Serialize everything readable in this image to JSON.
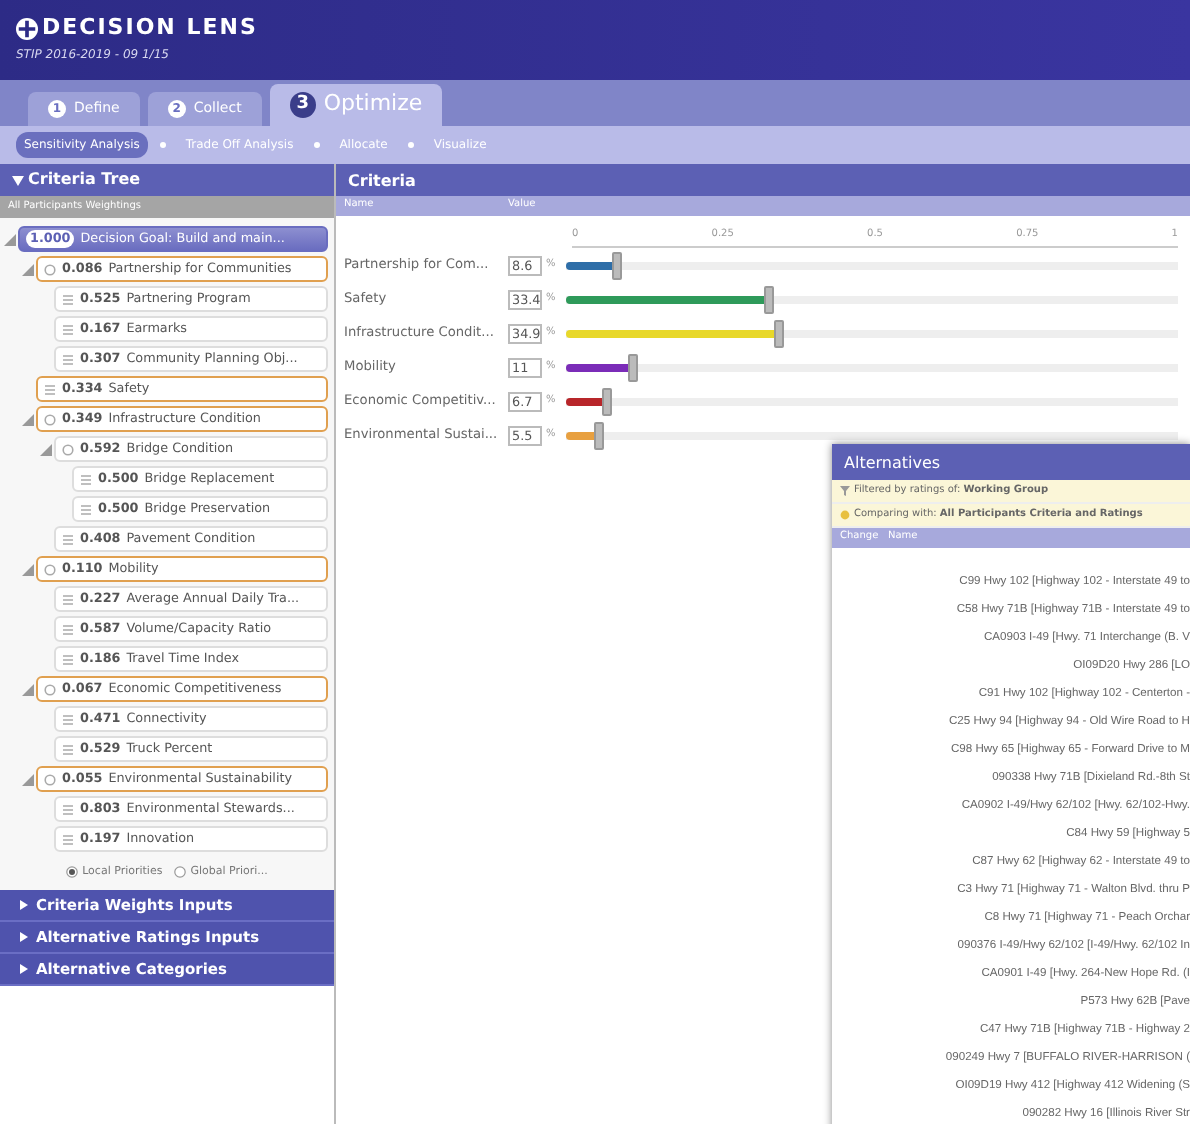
{
  "app": {
    "title": "DECISION LENS",
    "subtitle": "STIP 2016-2019 - 09 1/15"
  },
  "tabs": [
    {
      "number": "1",
      "label": "Define",
      "selected": false
    },
    {
      "number": "2",
      "label": "Collect",
      "selected": false
    },
    {
      "number": "3",
      "label": "Optimize",
      "selected": true
    }
  ],
  "subnav": [
    {
      "label": "Sensitivity Analysis",
      "selected": true
    },
    {
      "label": "Trade Off Analysis",
      "selected": false
    },
    {
      "label": "Allocate",
      "selected": false
    },
    {
      "label": "Visualize",
      "selected": false
    }
  ],
  "criteria_tree": {
    "title": "Criteria Tree",
    "subheader": "All Participants Weightings",
    "nodes": [
      {
        "kind": "goal",
        "value": "1.000",
        "label": "Decision Goal: Build and main...",
        "highlighted": false,
        "expanded": true,
        "children": [
          {
            "kind": "group",
            "value": "0.086",
            "label": "Partnership for Communities",
            "highlighted": true,
            "expanded": true,
            "children": [
              {
                "kind": "leaf",
                "value": "0.525",
                "label": "Partnering Program",
                "highlighted": false
              },
              {
                "kind": "leaf",
                "value": "0.167",
                "label": "Earmarks",
                "highlighted": false
              },
              {
                "kind": "leaf",
                "value": "0.307",
                "label": "Community Planning Obj...",
                "highlighted": false
              }
            ]
          },
          {
            "kind": "leaf",
            "value": "0.334",
            "label": "Safety",
            "highlighted": true
          },
          {
            "kind": "group",
            "value": "0.349",
            "label": "Infrastructure Condition",
            "highlighted": true,
            "expanded": true,
            "children": [
              {
                "kind": "group",
                "value": "0.592",
                "label": "Bridge Condition",
                "highlighted": false,
                "expanded": true,
                "children": [
                  {
                    "kind": "leaf",
                    "value": "0.500",
                    "label": "Bridge Replacement",
                    "highlighted": false
                  },
                  {
                    "kind": "leaf",
                    "value": "0.500",
                    "label": "Bridge Preservation",
                    "highlighted": false
                  }
                ]
              },
              {
                "kind": "leaf",
                "value": "0.408",
                "label": "Pavement Condition",
                "highlighted": false
              }
            ]
          },
          {
            "kind": "group",
            "value": "0.110",
            "label": "Mobility",
            "highlighted": true,
            "expanded": true,
            "children": [
              {
                "kind": "leaf",
                "value": "0.227",
                "label": "Average Annual Daily Tra...",
                "highlighted": false
              },
              {
                "kind": "leaf",
                "value": "0.587",
                "label": "Volume/Capacity Ratio",
                "highlighted": false
              },
              {
                "kind": "leaf",
                "value": "0.186",
                "label": "Travel Time Index",
                "highlighted": false
              }
            ]
          },
          {
            "kind": "group",
            "value": "0.067",
            "label": "Economic Competitiveness",
            "highlighted": true,
            "expanded": true,
            "children": [
              {
                "kind": "leaf",
                "value": "0.471",
                "label": "Connectivity",
                "highlighted": false
              },
              {
                "kind": "leaf",
                "value": "0.529",
                "label": "Truck Percent",
                "highlighted": false
              }
            ]
          },
          {
            "kind": "group",
            "value": "0.055",
            "label": "Environmental Sustainability",
            "highlighted": true,
            "expanded": true,
            "children": [
              {
                "kind": "leaf",
                "value": "0.803",
                "label": "Environmental Stewards...",
                "highlighted": false
              },
              {
                "kind": "leaf",
                "value": "0.197",
                "label": "Innovation",
                "highlighted": false
              }
            ]
          }
        ]
      }
    ],
    "priority_options": [
      {
        "label": "Local Priorities",
        "selected": true
      },
      {
        "label": "Global Priori...",
        "selected": false
      }
    ]
  },
  "collapsed_sections": [
    {
      "label": "Criteria Weights Inputs",
      "expanded": false
    },
    {
      "label": "Alternative Ratings Inputs",
      "expanded": false
    },
    {
      "label": "Alternative Categories",
      "expanded": false
    }
  ],
  "criteria": {
    "title": "Criteria",
    "columns": [
      "Name",
      "Value"
    ],
    "scale": [
      "0",
      "0.25",
      "0.5",
      "0.75",
      "1"
    ],
    "rows": [
      {
        "name": "Partnership for Com...",
        "value": "8.6",
        "unit": "%",
        "level": 0.086,
        "color": "#2e6ea8"
      },
      {
        "name": "Safety",
        "value": "33.4",
        "unit": "%",
        "level": 0.334,
        "color": "#2e9a5a"
      },
      {
        "name": "Infrastructure Condit...",
        "value": "34.9",
        "unit": "%",
        "level": 0.349,
        "color": "#e8d82a"
      },
      {
        "name": "Mobility",
        "value": "11",
        "unit": "%",
        "level": 0.11,
        "color": "#7b2cb8"
      },
      {
        "name": "Economic Competitiv...",
        "value": "6.7",
        "unit": "%",
        "level": 0.067,
        "color": "#b8262a"
      },
      {
        "name": "Environmental Sustai...",
        "value": "5.5",
        "unit": "%",
        "level": 0.055,
        "color": "#e8a040"
      }
    ]
  },
  "alternatives": {
    "title": "Alternatives",
    "filter_label": "Filtered by ratings of:",
    "filter_value": "Working Group",
    "compare_label": "Comparing with:",
    "compare_value": "All Participants Criteria and Ratings",
    "columns": [
      "Change",
      "Name"
    ],
    "rows": [
      "C99 Hwy 102 [Highway 102 - Interstate 49 to",
      "C58 Hwy 71B [Highway 71B - Interstate 49 to",
      "CA0903 I-49 [Hwy. 71 Interchange (B. V",
      "OI09D20 Hwy 286 [LO",
      "C91 Hwy 102 [Highway 102 - Centerton -",
      "C25 Hwy 94 [Highway 94 - Old Wire Road to H",
      "C98 Hwy 65 [Highway 65 - Forward Drive to M",
      "090338 Hwy 71B [Dixieland Rd.-8th St",
      "CA0902 I-49/Hwy 62/102 [Hwy. 62/102-Hwy.",
      "C84 Hwy 59 [Highway 5",
      "C87 Hwy 62 [Highway 62 - Interstate 49 to",
      "C3 Hwy 71 [Highway 71 - Walton Blvd. thru P",
      "C8 Hwy 71 [Highway 71 - Peach Orchar",
      "090376 I-49/Hwy 62/102 [I-49/Hwy. 62/102 In",
      "CA0901 I-49 [Hwy. 264-New Hope Rd. (I",
      "P573 Hwy 62B [Pave",
      "C47 Hwy 71B [Highway 71B - Highway 2",
      "090249 Hwy 7 [BUFFALO RIVER-HARRISON (",
      "OI09D19 Hwy 412 [Highway 412 Widening (S",
      "090282 Hwy 16 [Illinois River Str"
    ]
  }
}
